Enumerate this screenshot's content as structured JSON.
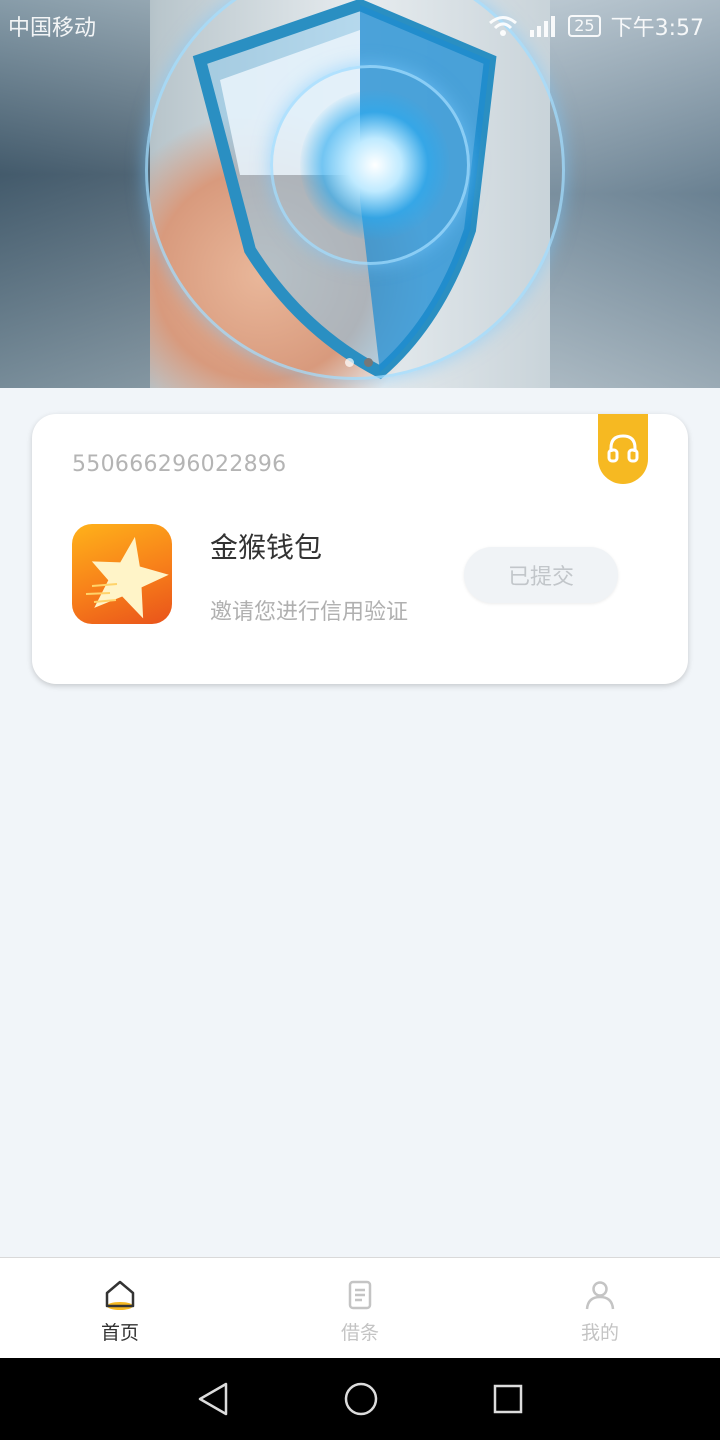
{
  "statusbar": {
    "carrier": "中国移动",
    "battery": "25",
    "time": "下午3:57"
  },
  "banner": {
    "slide_count": 2,
    "active_slide": 2
  },
  "card": {
    "order_number": "550666296022896",
    "app_name": "金猴钱包",
    "app_subtitle": "邀请您进行信用验证",
    "status_label": "已提交",
    "service_icon": "headset-icon"
  },
  "tabs": [
    {
      "label": "首页",
      "icon": "home-icon",
      "active": true
    },
    {
      "label": "借条",
      "icon": "document-icon",
      "active": false
    },
    {
      "label": "我的",
      "icon": "user-icon",
      "active": false
    }
  ],
  "colors": {
    "accent": "#f6b922",
    "background": "#f1f5f9",
    "app_icon_orange": "#f77f1a"
  }
}
